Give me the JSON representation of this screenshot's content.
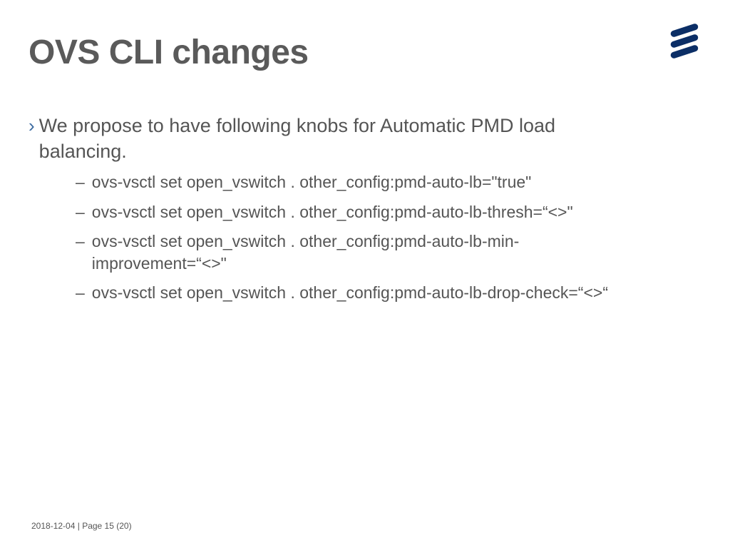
{
  "title": "OVS CLI changes",
  "logo": {
    "name": "ericsson-logo",
    "color": "#0b2e66"
  },
  "bullet": {
    "prefix": "›",
    "text": "We propose to have following knobs for Automatic PMD load balancing."
  },
  "sub": [
    "ovs-vsctl set open_vswitch . other_config:pmd-auto-lb=\"true\"",
    "ovs-vsctl set open_vswitch . other_config:pmd-auto-lb-thresh=“<>\"",
    "ovs-vsctl set open_vswitch . other_config:pmd-auto-lb-min-improvement=“<>\"",
    "ovs-vsctl set open_vswitch . other_config:pmd-auto-lb-drop-check=“<>“"
  ],
  "footer": {
    "date": "2018-12-04",
    "sep": "  |  ",
    "page_label": "Page 15 (20)"
  }
}
